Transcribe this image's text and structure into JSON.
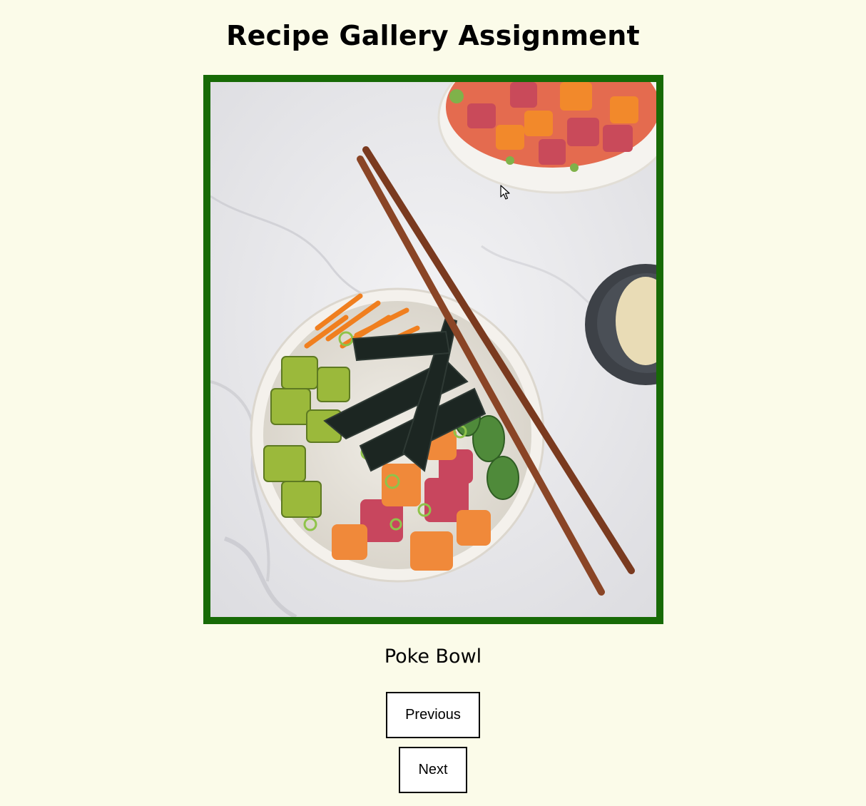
{
  "page": {
    "title": "Recipe Gallery Assignment"
  },
  "gallery": {
    "current_image": {
      "caption": "Poke Bowl",
      "frame_color": "#176a06"
    },
    "controls": {
      "previous_label": "Previous",
      "next_label": "Next"
    }
  },
  "colors": {
    "background": "#fbfbe9",
    "frame": "#176a06"
  },
  "icons": {
    "cursor": "mouse-pointer-icon"
  }
}
